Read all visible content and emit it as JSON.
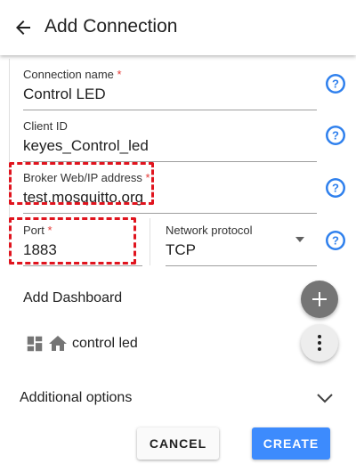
{
  "header": {
    "title": "Add Connection"
  },
  "fields": {
    "connection_name": {
      "label": "Connection name",
      "required": "*",
      "value": "Control LED"
    },
    "client_id": {
      "label": "Client ID",
      "value": "keyes_Control_led"
    },
    "broker": {
      "label": "Broker Web/IP address",
      "required": "*",
      "value": "test.mosquitto.org"
    },
    "port": {
      "label": "Port",
      "required": "*",
      "value": "1883"
    },
    "protocol": {
      "label": "Network protocol",
      "value": "TCP"
    }
  },
  "dashboard": {
    "label": "Add Dashboard",
    "items": [
      {
        "label": "control led"
      }
    ]
  },
  "additional": {
    "label": "Additional options"
  },
  "buttons": {
    "cancel": "CANCEL",
    "create": "CREATE"
  },
  "colors": {
    "accent": "#3d8bfd",
    "help": "#2f80ed",
    "highlight": "#e0141e",
    "fab": "#757575"
  }
}
